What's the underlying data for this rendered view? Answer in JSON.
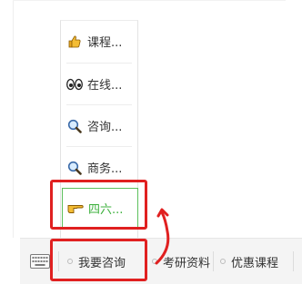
{
  "popup_menu": {
    "items": [
      {
        "label": "课程...",
        "icon": "thumbs-up-icon"
      },
      {
        "label": "在线...",
        "icon": "eyes-icon"
      },
      {
        "label": "咨询...",
        "icon": "magnifier-icon"
      },
      {
        "label": "商务...",
        "icon": "magnifier-icon"
      },
      {
        "label": "四六...",
        "icon": "pointing-hand-icon",
        "active": true
      }
    ]
  },
  "bottom_bar": {
    "keyboard_icon": "keyboard-icon",
    "tabs": [
      {
        "label": "我要咨询"
      },
      {
        "label": "考研资料"
      },
      {
        "label": "优惠课程"
      }
    ]
  },
  "colors": {
    "active_green": "#3db03d",
    "annotation_red": "#e02020"
  }
}
